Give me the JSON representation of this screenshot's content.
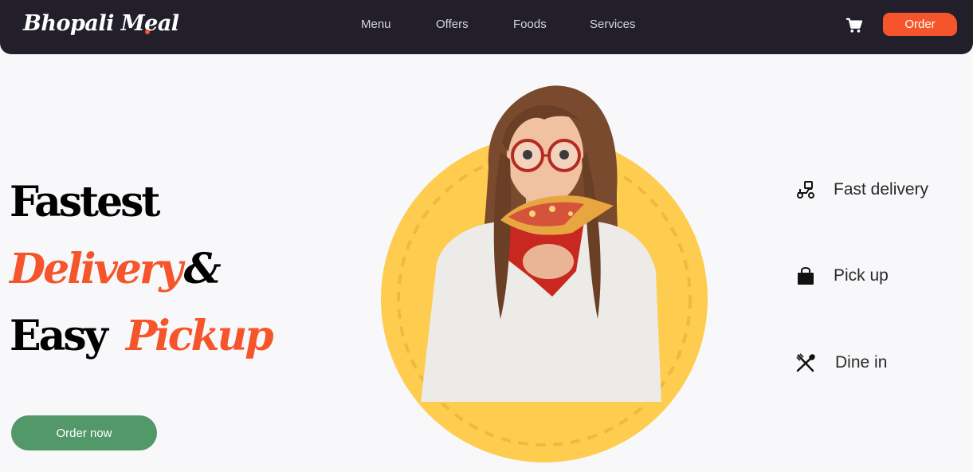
{
  "brand": {
    "name": "Bhopali Meal",
    "dot_color": "#f6552b"
  },
  "nav": {
    "links": [
      "Menu",
      "Offers",
      "Foods",
      "Services"
    ],
    "cart_icon": "cart-icon",
    "order_label": "Order"
  },
  "hero": {
    "line1": "Fastest",
    "line2_accent": "Delivery",
    "line2_rest": "&",
    "line3_plain": "Easy",
    "line3_accent": "Pickup",
    "cta_label": "Order now",
    "image_icon": "woman-eating-pizza-photo"
  },
  "features": [
    {
      "icon": "scooter-icon",
      "label": "Fast delivery"
    },
    {
      "icon": "shopping-bag-icon",
      "label": "Pick up"
    },
    {
      "icon": "fork-spoon-icon",
      "label": "Dine in"
    }
  ],
  "colors": {
    "nav_bg": "#221f2b",
    "accent": "#f6552b",
    "cta_green": "#529869",
    "circle_yellow": "#fecc4e",
    "page_bg": "#f8f8fa"
  }
}
